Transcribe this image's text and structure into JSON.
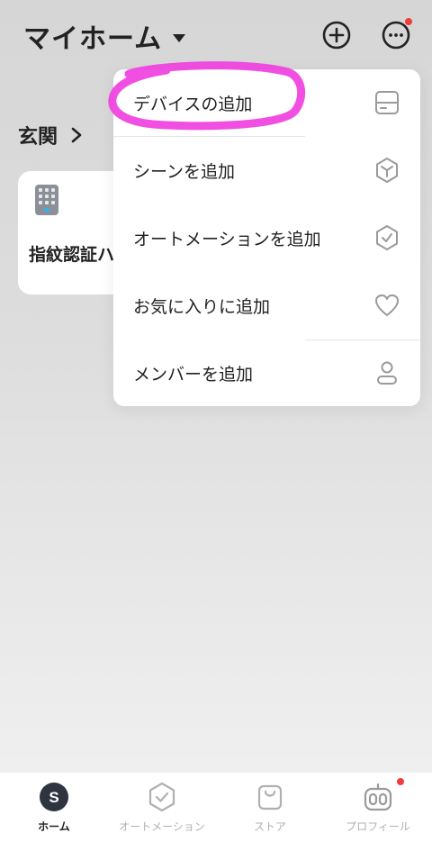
{
  "header": {
    "home_title": "マイホーム",
    "add_icon": "plus-circle-icon",
    "more_icon": "more-horizontal-circle-icon"
  },
  "room": {
    "name": "玄関"
  },
  "device_card": {
    "name": "指紋認証ハ",
    "icon": "keypad-device-icon"
  },
  "menu": {
    "items": [
      {
        "label": "デバイスの追加",
        "icon": "device-icon"
      },
      {
        "label": "シーンを追加",
        "icon": "scene-hexagon-icon"
      },
      {
        "label": "オートメーションを追加",
        "icon": "automation-check-icon"
      },
      {
        "label": "お気に入りに追加",
        "icon": "heart-icon"
      },
      {
        "label": "メンバーを追加",
        "icon": "person-icon"
      }
    ]
  },
  "bottom_nav": {
    "items": [
      {
        "label": "ホーム",
        "icon": "home-s-icon",
        "active": true
      },
      {
        "label": "オートメーション",
        "icon": "automation-icon",
        "active": false
      },
      {
        "label": "ストア",
        "icon": "store-bag-icon",
        "active": false
      },
      {
        "label": "プロフィール",
        "icon": "profile-robot-icon",
        "active": false
      }
    ]
  },
  "colors": {
    "highlight": "#f040e0",
    "notification_dot": "#f23b3b",
    "text_primary": "#222222",
    "text_inactive": "#b0b0b0",
    "icon_gray": "#9a9a9a"
  }
}
